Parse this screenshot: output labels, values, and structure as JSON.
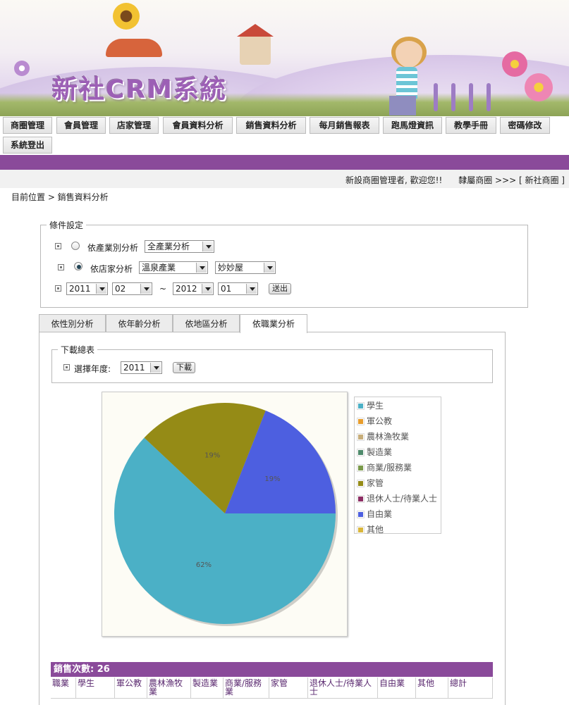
{
  "banner": {
    "title": "新社CRM系統"
  },
  "nav": {
    "items": [
      "商圈管理",
      "會員管理",
      "店家管理",
      "會員資料分析",
      "銷售資料分析",
      "每月銷售報表",
      "跑馬燈資訊",
      "教學手冊",
      "密碼修改",
      "系統登出"
    ]
  },
  "header": {
    "welcome": "新設商圈管理者, 歡迎您!!",
    "affiliation": "隸屬商圈 >>> [ 新社商圈 ]"
  },
  "breadcrumb": "目前位置 > 銷售資料分析",
  "conditions": {
    "legend": "條件設定",
    "by_industry_label": "依產業別分析",
    "industry_select": "全產業分析",
    "by_store_label": "依店家分析",
    "store_category_select": "溫泉產業",
    "store_select": "妙妙屋",
    "start_year": "2011",
    "start_month": "02",
    "tilde": "~",
    "end_year": "2012",
    "end_month": "01",
    "submit": "送出"
  },
  "tabs": [
    "依性別分析",
    "依年齡分析",
    "依地區分析",
    "依職業分析"
  ],
  "download": {
    "legend": "下載總表",
    "year_label": "選擇年度:",
    "year_value": "2011",
    "button": "下載"
  },
  "chart_data": {
    "type": "pie",
    "legend": [
      "學生",
      "軍公教",
      "農林漁牧業",
      "製造業",
      "商業/服務業",
      "家管",
      "退休人士/待業人士",
      "自由業",
      "其他"
    ],
    "legend_colors": [
      "#4bb0c6",
      "#e89d2c",
      "#c7ad7a",
      "#4f8b6c",
      "#7a9a4a",
      "#958b16",
      "#8d2e64",
      "#4d5fe0",
      "#d9b63b"
    ],
    "slices": [
      {
        "label": "學生",
        "value": 62,
        "text": "62%",
        "color": "#4bb0c6"
      },
      {
        "label": "家管",
        "value": 19,
        "text": "19%",
        "color": "#958b16"
      },
      {
        "label": "自由業",
        "value": 19,
        "text": "19%",
        "color": "#4d5fe0"
      }
    ],
    "legend_position": "right"
  },
  "table": {
    "title": "銷售次數: 26",
    "columns": [
      "職業",
      "學生",
      "軍公教",
      "農林漁牧業",
      "製造業",
      "商業/服務業",
      "家管",
      "退休人士/待業人士",
      "自由業",
      "其他",
      "總計"
    ]
  }
}
